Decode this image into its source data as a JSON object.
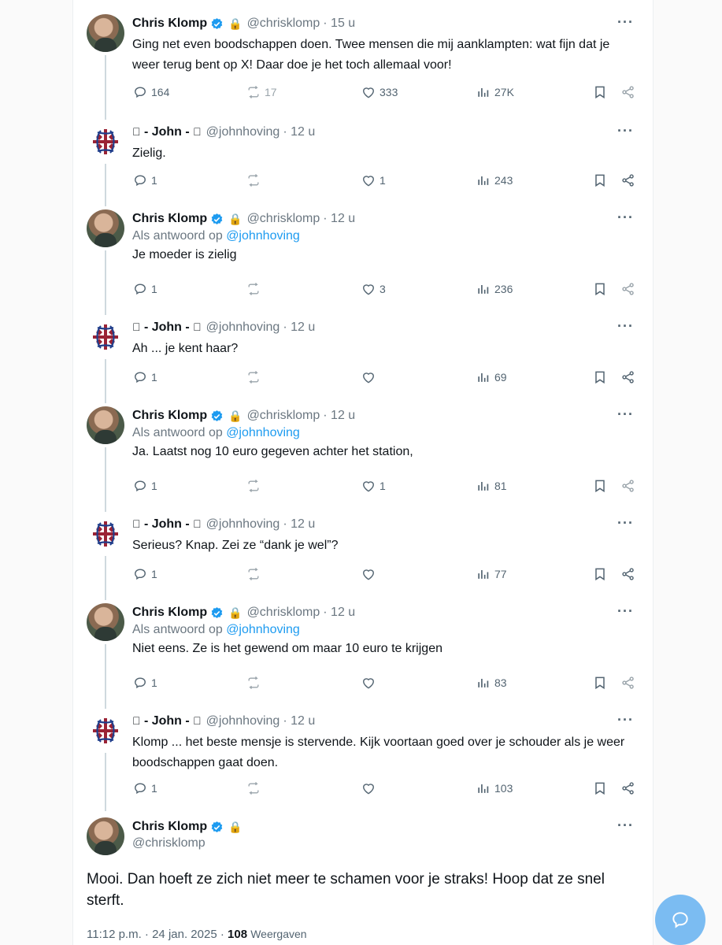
{
  "colors": {
    "accent": "#1d9bf0",
    "text": "#0f1419",
    "secondary": "#536471",
    "fab": "#7bbcf2"
  },
  "replies": [
    {
      "name": "Chris Klomp",
      "verified": true,
      "locked": true,
      "avatar": "photo",
      "handle": "@chrisklomp",
      "time": "· 15 u",
      "reply_prefix": "",
      "reply_handle": "",
      "text": "Ging net even boodschappen doen. Twee mensen die mij aanklampten: wat fijn dat je weer terug bent op X! Daar doe je het toch allemaal voor!",
      "replies": "164",
      "reposts": "17",
      "likes": "333",
      "views": "27K"
    },
    {
      "name": "- John -",
      "apple": "",
      "avatar": "logo",
      "handle": "@johnhoving",
      "time": "· 12 u",
      "reply_prefix": "",
      "reply_handle": "",
      "text": "Zielig.",
      "replies": "1",
      "reposts": "",
      "likes": "1",
      "views": "243"
    },
    {
      "name": "Chris Klomp",
      "verified": true,
      "locked": true,
      "avatar": "photo",
      "handle": "@chrisklomp",
      "time": "· 12 u",
      "reply_prefix": "Als antwoord op",
      "reply_handle": "@johnhoving",
      "text": "Je moeder is zielig",
      "replies": "1",
      "reposts": "",
      "likes": "3",
      "views": "236"
    },
    {
      "name": "- John -",
      "apple": "",
      "avatar": "logo",
      "handle": "@johnhoving",
      "time": "· 12 u",
      "reply_prefix": "",
      "reply_handle": "",
      "text": "Ah ... je kent haar?",
      "replies": "1",
      "reposts": "",
      "likes": "",
      "views": "69"
    },
    {
      "name": "Chris Klomp",
      "verified": true,
      "locked": true,
      "avatar": "photo",
      "handle": "@chrisklomp",
      "time": "· 12 u",
      "reply_prefix": "Als antwoord op",
      "reply_handle": "@johnhoving",
      "text": "Ja. Laatst nog 10 euro gegeven achter het station,",
      "replies": "1",
      "reposts": "",
      "likes": "1",
      "views": "81"
    },
    {
      "name": "- John -",
      "apple": "",
      "avatar": "logo",
      "handle": "@johnhoving",
      "time": "· 12 u",
      "reply_prefix": "",
      "reply_handle": "",
      "text": "Serieus? Knap. Zei ze “dank je wel”?",
      "replies": "1",
      "reposts": "",
      "likes": "",
      "views": "77"
    },
    {
      "name": "Chris Klomp",
      "verified": true,
      "locked": true,
      "avatar": "photo",
      "handle": "@chrisklomp",
      "time": "· 12 u",
      "reply_prefix": "Als antwoord op",
      "reply_handle": "@johnhoving",
      "text": "Niet eens. Ze is het gewend om maar 10 euro te krijgen",
      "replies": "1",
      "reposts": "",
      "likes": "",
      "views": "83"
    },
    {
      "name": "- John -",
      "apple": "",
      "avatar": "logo",
      "handle": "@johnhoving",
      "time": "· 12 u",
      "reply_prefix": "",
      "reply_handle": "",
      "text": "Klomp ... het beste mensje is stervende. Kijk voortaan goed over je schouder als je weer boodschappen gaat doen.",
      "replies": "1",
      "reposts": "",
      "likes": "",
      "views": "103"
    }
  ],
  "main": {
    "name": "Chris Klomp",
    "handle": "@chrisklomp",
    "text": "Mooi. Dan hoeft ze zich niet meer te schamen voor je straks! Hoop dat ze snel sterft.",
    "timestamp": "11:12 p.m. · 24 jan. 2025 ·",
    "views_count": "108",
    "views_label": "Weergaven"
  }
}
